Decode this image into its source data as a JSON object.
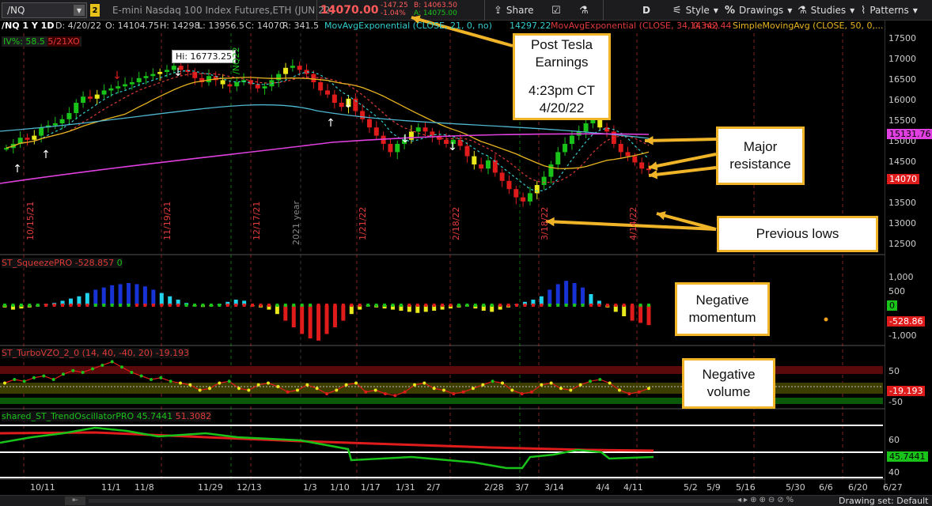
{
  "toolbar": {
    "symbol": "/NQ",
    "link_badge": "2",
    "instrument_description": "E-mini Nasdaq 100 Index Futures,ETH (JUN 22)",
    "last_price": "14070.00",
    "change": "-147.25",
    "change_pct": "-1.04%",
    "bid": "B: 14063.50",
    "ask": "A: 14075.00",
    "share_label": "Share",
    "aggregation": "D",
    "style_label": "Style",
    "drawings_label": "Drawings",
    "studies_label": "Studies",
    "patterns_label": "Patterns"
  },
  "chart_header": {
    "title": "/NQ 1 Y 1D",
    "date": "D: 4/20/22",
    "open": "O: 14104.75",
    "high": "H: 14298",
    "low": "L: 13956.5",
    "close": "C: 14070",
    "range": "R: 341.5",
    "ema21_label": "MovAvgExponential (CLOSE, 21, 0, no)",
    "ema21_value": "14297.22",
    "ema34_label": "MovAvgExponential (CLOSE, 34, 0, no)",
    "ema34_value": "14342.44",
    "sma50_label": "SimpleMovingAvg (CLOSE, 50, 0,...",
    "iv_label": "IV%: 58.5",
    "iv_date": "5/21XO",
    "hi_tooltip": "Hi: 16773.25"
  },
  "price_axis": {
    "ticks": [
      "17500",
      "17000",
      "16500",
      "16000",
      "15500",
      "15000",
      "14500",
      "14000",
      "13500",
      "13000",
      "12500"
    ],
    "tag_sma": "15131.76",
    "tag_last": "14070"
  },
  "squeeze": {
    "label": "ST_SqueezePRO",
    "value": "-528.857",
    "zero_value": "0",
    "ticks": [
      "1,000",
      "500",
      "0",
      "-500",
      "-1,000"
    ],
    "tag_value": "-528.86"
  },
  "turbo": {
    "label": "ST_TurboVZO_2_0 (14, 40, -40, 20)",
    "value": "-19.193",
    "ticks": [
      "50",
      "0",
      "-50"
    ],
    "tag_value": "-19.193"
  },
  "trend": {
    "label": "shared_ST_TrendOscillatorPRO",
    "green_value": "45.7441",
    "red_value": "51.3082",
    "ticks": [
      "60",
      "40"
    ],
    "tag_value": "45.7441"
  },
  "x_axis": {
    "labels": [
      "10/11",
      "11/1",
      "11/8",
      "11/29",
      "12/13",
      "1/3",
      "1/10",
      "1/17",
      "1/31",
      "2/7",
      "2/28",
      "3/7",
      "3/14",
      "4/4",
      "4/11",
      "5/2",
      "5/9",
      "5/16",
      "5/30",
      "6/6",
      "6/20",
      "6/27"
    ]
  },
  "vertical_dates": [
    "10/15/21",
    "11/19/21",
    "12/17/21",
    "2021 year",
    "1/21/22",
    "2/18/22",
    "3/18/22",
    "4/14/22",
    "/NQ22"
  ],
  "callouts": {
    "tesla": [
      "Post Tesla",
      "Earnings",
      "",
      "4:23pm CT",
      "4/20/22"
    ],
    "resistance": [
      "Major",
      "resistance"
    ],
    "lows": [
      "Previous lows"
    ],
    "momentum": [
      "Negative",
      "momentum"
    ],
    "volume": [
      "Negative",
      "volume"
    ]
  },
  "status_bar": {
    "drawing_set": "Drawing set: Default"
  },
  "colors": {
    "up_candle": "#19c319",
    "down_candle": "#e01b1b",
    "neutral_candle": "#e8e81a",
    "ema21": "#33cccc",
    "ema34": "#e03a3a",
    "sma50": "#e8b420",
    "ma_magenta": "#e040e0",
    "ma_cyan": "#4fb6d0",
    "callout_border": "#f0b429"
  }
}
